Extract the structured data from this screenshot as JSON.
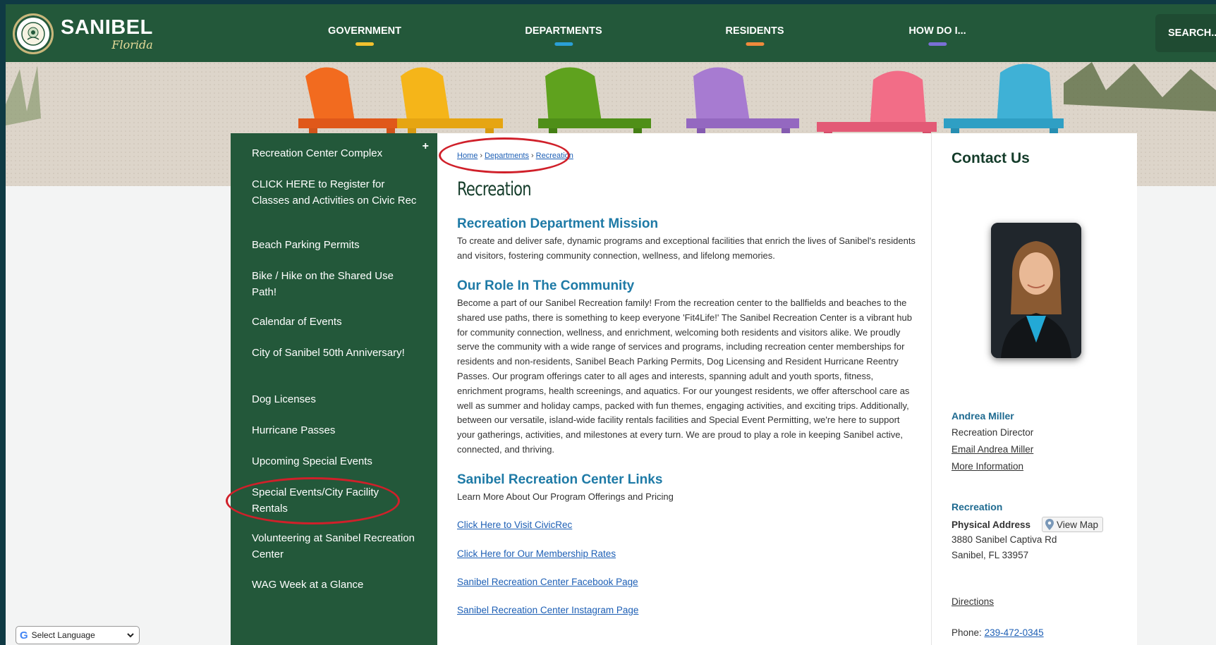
{
  "header": {
    "logo_name": "SANIBEL",
    "logo_sub": "Florida",
    "nav": [
      {
        "label": "GOVERNMENT",
        "color": "#f2c12e"
      },
      {
        "label": "DEPARTMENTS",
        "color": "#2a9fd6"
      },
      {
        "label": "RESIDENTS",
        "color": "#f08a3c"
      },
      {
        "label": "HOW DO I...",
        "color": "#7a6fd6"
      }
    ],
    "search_label": "SEARCH..."
  },
  "sidebar": {
    "items": [
      {
        "label": "Recreation Center Complex"
      },
      {
        "label": "CLICK HERE to Register for Classes and Activities on Civic Rec"
      },
      {
        "label": "Beach Parking Permits"
      },
      {
        "label": "Bike / Hike on the Shared Use Path!"
      },
      {
        "label": "Calendar of Events"
      },
      {
        "label": "City of Sanibel 50th Anniversary!"
      },
      {
        "label": "Dog Licenses"
      },
      {
        "label": "Hurricane Passes"
      },
      {
        "label": "Upcoming Special Events"
      },
      {
        "label": "Special Events/City Facility Rentals"
      },
      {
        "label": "Volunteering at Sanibel Recreation Center"
      },
      {
        "label": "WAG Week at a Glance"
      }
    ],
    "expand_symbol": "+"
  },
  "breadcrumb": {
    "home": "Home",
    "departments": "Departments",
    "recreation": "Recreation",
    "sep": "›"
  },
  "main": {
    "title": "Recreation",
    "mission_heading": "Recreation Department Mission",
    "mission_text": "To create and deliver safe, dynamic programs and exceptional facilities that enrich the lives of Sanibel's residents and visitors, fostering community connection, wellness, and lifelong memories.",
    "role_heading": "Our Role In The Community",
    "role_text": "Become a part of our Sanibel Recreation family!  From the recreation center to the ballfields and beaches to the shared use paths, there is something to keep everyone 'Fit4Life!' The Sanibel Recreation Center is a vibrant hub for community connection, wellness, and enrichment, welcoming both residents and visitors alike. We proudly serve the community with a wide range of services and programs, including recreation center memberships for residents and non-residents, Sanibel Beach Parking Permits, Dog Licensing and Resident Hurricane Reentry Passes. Our program offerings cater to all ages and interests, spanning adult and youth sports, fitness, enrichment programs, health screenings, and aquatics. For our youngest residents, we offer afterschool care as well as summer and holiday camps, packed with fun themes, engaging activities, and exciting trips. Additionally, between our versatile, island-wide facility rentals facilities and Special Event Permitting, we're here to support your gatherings, activities, and milestones at every turn. We are proud to play a role in keeping Sanibel active, connected, and thriving.",
    "links_heading": "Sanibel Recreation Center Links",
    "links_intro": "Learn More About Our Program Offerings and Pricing",
    "links": [
      "Click Here to Visit CivicRec",
      "Click Here for Our Membership Rates",
      "Sanibel Recreation Center Facebook Page",
      "Sanibel Recreation Center Instagram Page"
    ]
  },
  "contact": {
    "title": "Contact Us",
    "name": "Andrea Miller",
    "role": "Recreation Director",
    "email_link": "Email Andrea Miller",
    "more_info_link": "More Information",
    "section": "Recreation",
    "address_label": "Physical Address",
    "view_map": "View Map",
    "address_line1": "3880 Sanibel Captiva Rd",
    "address_line2": "Sanibel, FL 33957",
    "directions": "Directions",
    "phone_label": "Phone:",
    "phone": "239-472-0345"
  },
  "language": {
    "label": "Select Language"
  },
  "colors": {
    "brand_green": "#23583a",
    "heading_blue": "#1e7aa6",
    "annotation_red": "#d0202a"
  }
}
